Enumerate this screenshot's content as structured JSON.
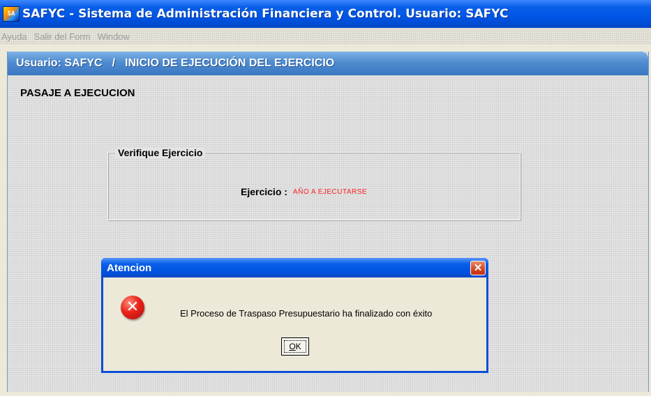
{
  "window": {
    "icon": "safyc-app-icon",
    "icon_text": "SA",
    "title": "SAFYC - Sistema de Administración Financiera y Control. Usuario: SAFYC"
  },
  "menu": {
    "items": [
      "Ayuda",
      "Salir del Form",
      "Window"
    ]
  },
  "form": {
    "header_user": "Usuario: SAFYC",
    "header_separator": "/",
    "header_title": "INICIO DE EJECUCIÓN DEL EJERCICIO",
    "section_title": "PASAJE A EJECUCION",
    "group_legend": "Verifique Ejercicio",
    "ejercicio_label": "Ejercicio :",
    "ejercicio_value": "AÑO A EJECUTARSE",
    "ejercicio_value_color": "#ff2020"
  },
  "dialog": {
    "title": "Atencion",
    "close_icon": "close-icon",
    "close_symbol": "✕",
    "icon": "error-icon",
    "icon_symbol": "✕",
    "message": "El Proceso de Traspaso Presupuestario ha finalizado con éxito",
    "ok_label": "OK"
  },
  "colors": {
    "titlebar_blue": "#0055e5",
    "form_header_blue": "#4f8cd0",
    "close_red": "#d7441f",
    "error_red": "#e8221a"
  }
}
